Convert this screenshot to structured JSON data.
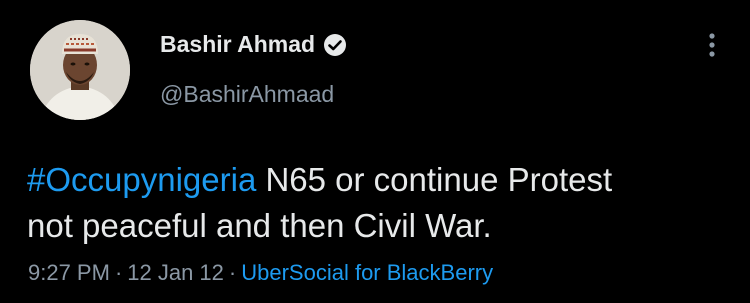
{
  "tweet": {
    "display_name": "Bashir Ahmad",
    "handle": "@BashirAhmaad",
    "verified": true,
    "hashtag": "#Occupynigeria",
    "text_line1_rest": " N65 or continue Protest",
    "text_line2": "not peaceful and then Civil War.",
    "time": "9:27 PM",
    "separator": "·",
    "date": "12 Jan 12",
    "source": "UberSocial for BlackBerry"
  },
  "colors": {
    "background": "#000000",
    "text": "#e7e9ea",
    "secondary": "#8b98a5",
    "accent": "#1d9bf0"
  },
  "icons": {
    "verified": "verified-badge-icon",
    "more": "more-vertical-icon"
  }
}
